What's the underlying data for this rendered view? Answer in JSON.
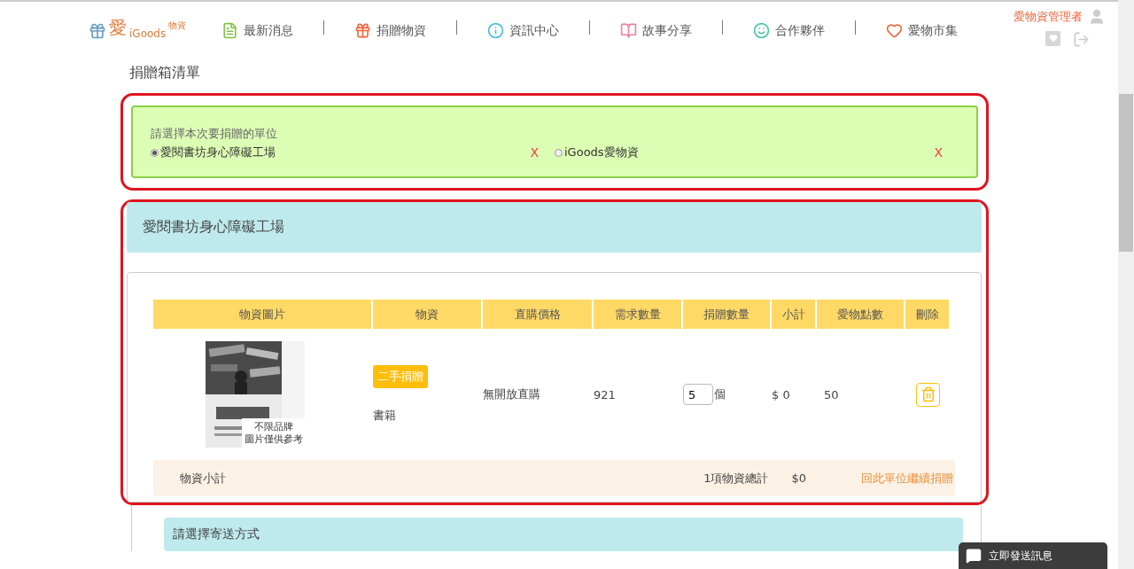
{
  "logo": {
    "mark": "愛",
    "sub": "物資",
    "brand": "iGoods"
  },
  "nav": [
    {
      "label": "最新消息"
    },
    {
      "label": "捐贈物資"
    },
    {
      "label": "資訊中心"
    },
    {
      "label": "故事分享"
    },
    {
      "label": "合作夥伴"
    },
    {
      "label": "愛物市集"
    }
  ],
  "user": {
    "name": "愛物資管理者"
  },
  "page_title": "捐贈箱清單",
  "unit_picker": {
    "prompt": "請選擇本次要捐贈的單位",
    "options": [
      {
        "label": "愛閱書坊身心障礙工場",
        "selected": true,
        "remove": "X"
      },
      {
        "label": "iGoods愛物資",
        "selected": false,
        "remove": "X"
      }
    ]
  },
  "unit_section": {
    "title": "愛閱書坊身心障礙工場",
    "table": {
      "columns": [
        "物資圖片",
        "物資",
        "直購價格",
        "需求數量",
        "捐贈數量",
        "小計",
        "愛物點數",
        "刪除"
      ],
      "rows": [
        {
          "caption": [
            "不限品牌",
            "圖片僅供參考"
          ],
          "tag": "二手捐贈",
          "item": "書籍",
          "price": "無開放直購",
          "needed": "921",
          "quantity": "5",
          "unit": "個",
          "subtotal": "$ 0",
          "points": "50"
        }
      ]
    },
    "summary": {
      "label": "物資小計",
      "count": "1項物資總計",
      "total": "$0",
      "link": "回此單位繼續捐贈"
    }
  },
  "shipping": {
    "title": "請選擇寄送方式"
  },
  "chat": {
    "label": "立即發送訊息"
  }
}
